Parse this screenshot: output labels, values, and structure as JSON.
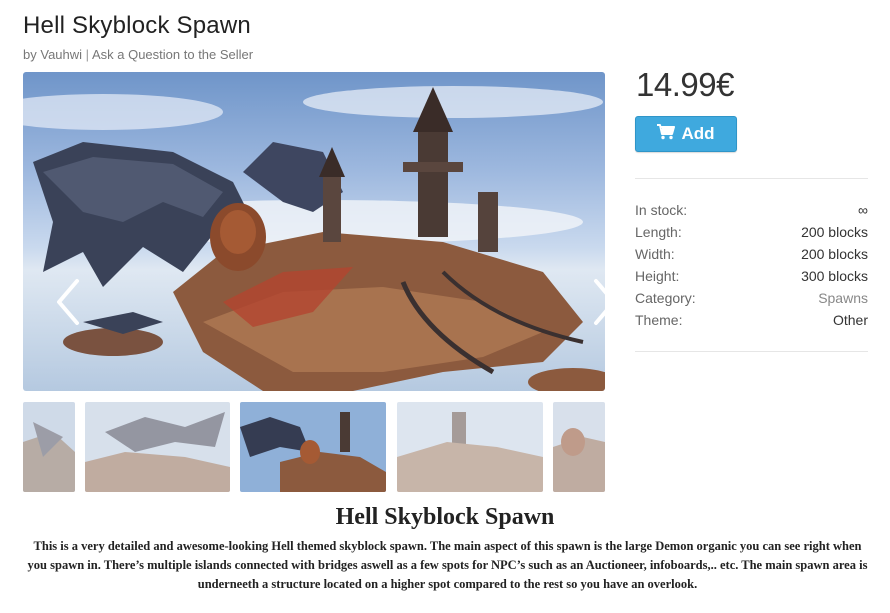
{
  "product": {
    "title": "Hell Skyblock Spawn",
    "by_prefix": "by",
    "author": "Vauhwi",
    "separator": "|",
    "ask_link": "Ask a Question to the Seller"
  },
  "purchase": {
    "price": "14.99€",
    "add_label": "Add",
    "add_icon": "shopping-cart-icon",
    "accent_color": "#3fa9de"
  },
  "specs": [
    {
      "label": "In stock:",
      "value": "∞"
    },
    {
      "label": "Length:",
      "value": "200 blocks"
    },
    {
      "label": "Width:",
      "value": "200 blocks"
    },
    {
      "label": "Height:",
      "value": "300 blocks"
    },
    {
      "label": "Category:",
      "value": "Spawns"
    },
    {
      "label": "Theme:",
      "value": "Other"
    }
  ],
  "gallery": {
    "prev_icon": "chevron-left-icon",
    "next_icon": "chevron-right-icon",
    "thumbnail_count": 5,
    "active_thumbnail": 3
  },
  "description": {
    "heading": "Hell Skyblock Spawn",
    "body": "This is a very detailed and awesome-looking Hell themed skyblock spawn. The main aspect of this spawn is the large Demon organic you can see right when you spawn in. There’s multiple islands connected with bridges aswell as a few spots for NPC’s such as an Auctioneer, infoboards,.. etc. The main spawn area is underneeth a structure located on a higher spot compared to the rest so you have an overlook."
  }
}
